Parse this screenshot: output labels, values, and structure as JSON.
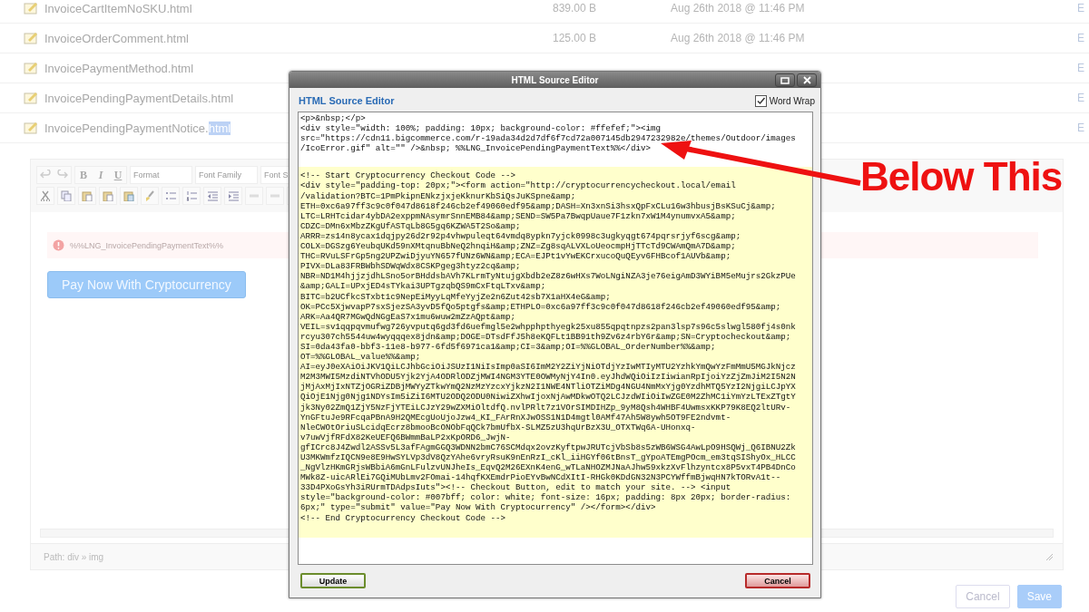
{
  "file_list": {
    "rows": [
      {
        "name": "InvoiceCartItemNoSKU.html",
        "size": "839.00 B",
        "date": "Aug 26th 2018 @ 11:46 PM",
        "column_4": "E"
      },
      {
        "name": "InvoiceOrderComment.html",
        "size": "125.00 B",
        "date": "Aug 26th 2018 @ 11:46 PM",
        "column_4": "E"
      },
      {
        "name": "InvoicePaymentMethod.html",
        "column_4": "E"
      },
      {
        "name": "InvoicePendingPaymentDetails.html",
        "column_4": "E"
      },
      {
        "name": "InvoicePendingPaymentNotice.",
        "selected_text": "html",
        "column_4": "E"
      }
    ]
  },
  "editor": {
    "toolbar": {
      "bold": "B",
      "italic": "I",
      "underline": "U",
      "format": "Format",
      "font_family": "Font Family",
      "font_size": "Font S"
    },
    "message": "%%LNG_InvoicePendingPaymentText%%",
    "button": "Pay Now With Cryptocurrency",
    "path": "Path: div » img"
  },
  "actions": [
    {
      "label": "Cancel",
      "kind": "secondary"
    },
    {
      "label": "Save",
      "kind": "primary"
    }
  ],
  "dialog": {
    "title": "HTML Source Editor",
    "heading": "HTML Source Editor",
    "word_wrap": {
      "label": "Word Wrap",
      "checked": true
    },
    "source_lines": [
      {
        "text": "<p>&nbsp;</p>",
        "highlighted": false
      },
      {
        "text": "<div style=\"width: 100%; padding: 10px; background-color: #ffefef;\"><img",
        "highlighted": false
      },
      {
        "text": "src=\"https://cdn11.bigcommerce.com/r-19ada34d2d7df6f7cd72a007145db2947232982e/themes/Outdoor/images",
        "highlighted": false
      },
      {
        "text": "/IcoError.gif\" alt=\"\" />&nbsp; %%LNG_InvoicePendingPaymentText%%</div>",
        "highlighted": false
      },
      {
        "text": "<!-- Start Cryptocurrency Checkout Code -->",
        "highlighted": true
      },
      {
        "text": "<div style=\"padding-top: 20px;\"><form action=\"http://cryptocurrencycheckout.local/email",
        "highlighted": true
      },
      {
        "text": "/validation?BTC=1PmPkipnENkzjxjeKknurKbSiQsJuKSpne&amp;",
        "highlighted": true
      },
      {
        "text": "ETH=0xc6a97ff3c9c0f047d8618f246cb2ef49060edf95&amp;DASH=Xn3xnSi3hsxQpFxCLu16w3hbusjBsKSuCj&amp;",
        "highlighted": true
      },
      {
        "text": "LTC=LRHTcidar4ybDA2exppmNAsymrSnnEMB84&amp;SEND=SW5Pa7BwqpUaue7F1zkn7xW1M4ynumvxA5&amp;",
        "highlighted": true
      },
      {
        "text": "CDZC=DMn6xMbzZKgUfASTqLb8G5gq6KZWA5T2So&amp;",
        "highlighted": true
      },
      {
        "text": "ARRR=zs14n8ycax1dqjpy26d2r92p4vhwpuleqt64vmdq8ypkn7yjck0998c3ugkyqgt674pqrsrjyf6scg&amp;",
        "highlighted": true
      },
      {
        "text": "COLX=DGSzg6YeubqUKd59nXMtqnuBbNeQ2hnqiH&amp;ZNZ=Zg8sqALVXLoUeocmpHjTTcTd9CWAmQmA7D&amp;",
        "highlighted": true
      },
      {
        "text": "THC=RVuLSFrGp5ng2UPZwiDjyuYN657fUNz6WN&amp;ECA=EJPt1vYwEKCrxucoQuQEyv6FHBcof1AUVb&amp;",
        "highlighted": true
      },
      {
        "text": "PIVX=DLa83FRBWbhSDWqWdx8CSKPgeg3htyz2cq&amp;",
        "highlighted": true
      },
      {
        "text": "NBR=ND1M4hjjzjdhLSno5orBHddsbAVh7KLrmTyNtujgXbdb2eZ8z6wHXs7WoLNgiNZA3je76eigAmD3WYiBM5eMujrs2GkzPUe",
        "highlighted": true
      },
      {
        "text": "&amp;GALI=UPxjED4sTYkai3UPTgzqbQS9mCxFtqLTxv&amp;",
        "highlighted": true
      },
      {
        "text": "BITC=b2UCfkcSTxbt1c9NepEiMyyLqMfeYyjZe2n6Zut42sb7X1aHX4eG&amp;",
        "highlighted": true
      },
      {
        "text": "OK=PCc5XjwvapP7sxSjezSA3yvD5fQo5ptgfs&amp;ETHPLO=0xc6a97ff3c9c0f047d8618f246cb2ef49060edf95&amp;",
        "highlighted": true
      },
      {
        "text": "ARK=Aa4QR7MGwQdNGgEaS7x1mu6wuw2mZzAQpt&amp;",
        "highlighted": true
      },
      {
        "text": "VEIL=sv1qqpqvmufwg726yvputq6gd3fd6uefmgl5e2whpphpthyegk25xu855qpqtnpzs2pan3lsp7s96c5slwgl580fj4s0nk",
        "highlighted": true
      },
      {
        "text": "rcyu307ch5544uw4wyqqqex8jdn&amp;DOGE=DTsdFfJ5h8eKQFLt1BB91th9Zv6z4rbY6r&amp;SN=Cryptocheckout&amp;",
        "highlighted": true
      },
      {
        "text": "SI=0da43fa0-bbf3-11e8-b977-6fd5f6971ca1&amp;CI=3&amp;OI=%%GLOBAL_OrderNumber%%&amp;",
        "highlighted": true
      },
      {
        "text": "OT=%%GLOBAL_value%%&amp;",
        "highlighted": true
      },
      {
        "text": "AI=eyJ0eXAiOiJKV1QiLCJhbGciOiJSUzI1NiIsImp0aSI6ImM2Y2ZiYjNiOTdjYzIwMTIyMTU2YzhkYmQwYzFmMmU5MGJkNjcz",
        "highlighted": true
      },
      {
        "text": "M2M3MWI5MzdiNTVhODU5Yjk2YjA4ODRlODZjMWI4NGM3YTE0OWMyNjY4In0.eyJhdWQiOiIzIiwianRpIjoiYzZjZmJiM2I5N2N",
        "highlighted": true
      },
      {
        "text": "jMjAxMjIxNTZjOGRiZDBjMWYyZTkwYmQ2NzMzYzcxYjkzN2I1NWE4NTliOTZiMDg4NGU4NmMxYjg0YzdhMTQ5YzI2NjgiLCJpYX",
        "highlighted": true
      },
      {
        "text": "QiOjE1Njg0Njg1NDYsIm5iZiI6MTU2ODQ2ODU0NiwiZXhwIjoxNjAwMDkwOTQ2LCJzdWIiOiIwZGE0M2ZhMC1iYmYzLTExZTgtY",
        "highlighted": true
      },
      {
        "text": "jk3Ny02ZmQ1ZjY5NzFjYTEiLCJzY29wZXMiOltdfQ.nvlPRlt7z1VOrSIMDIHZp_9yM8Qsh4WHBF4UwmsxKKP79K8EQ2ltURv-",
        "highlighted": true
      },
      {
        "text": "YnGFtuJe9RFcqaPBnA9H2QMEcgUoUjoJzw4_KI_FArRnXJwOSS1N1D4mgtl0AMf47Ah5W8ywh5OT9FE2ndvmt-",
        "highlighted": true
      },
      {
        "text": "NleCWOtOriuSLcidqEcrz8bmooBcONObFqQCk7bmUfbX-SLMZ5zU3hqUrBzX3U_OTXTWq6A-UHonxq-",
        "highlighted": true
      },
      {
        "text": "v7uwVjfRFdX82KeUEFQ6BWmmBaLP2xKpORD6_JwjN-",
        "highlighted": true
      },
      {
        "text": "gfICrc8J4Zwdl2ASSv5L3afFAgmGGQ3WDNN2bmC76SCMdqx2ovzKyftpwJRUTcjVbSb8s5zWB6WSG4AwLpO9HSQWj_Q6IBNU2Zk",
        "highlighted": true
      },
      {
        "text": "U3MKWmfzIQCN9e8E9HwSYLVp3dV8QzYAhe6vryRsuK9nEnRzI_cKl_iiHGYf06tBnsT_gYpoATEmgPOcm_em3tqSIShyOx_HLCC",
        "highlighted": true
      },
      {
        "text": "_NgVlzHKmGRjsWBbiA6mGnLFulzvUNJheIs_EqvQ2M26EXnK4enG_wTLaNHOZMJNaAJhw59xkzXvFlhzyntcx8P5vxT4PB4DnCo",
        "highlighted": true
      },
      {
        "text": "MWk8Z-uicARlEi7GQiMUbLmv2FOmai-14hqfKXEmdrPioEYvBwNCdXItI-RHGk0KDdGN32N3PCYWffmBjwqHN7kTORvA1t--",
        "highlighted": true
      },
      {
        "text": "33D4PXoGsYh3iRUrmTDAdpsIuts\"><!-- Checkout Button, edit to match your site. --> <input",
        "highlighted": true
      },
      {
        "text": "style=\"background-color: #007bff; color: white; font-size: 16px; padding: 8px 20px; border-radius:",
        "highlighted": true
      },
      {
        "text": "6px;\" type=\"submit\" value=\"Pay Now With Cryptocurrency\" /></form></div>",
        "highlighted": true
      },
      {
        "text": "<!-- End Cryptocurrency Checkout Code -->",
        "highlighted": true
      }
    ],
    "buttons": [
      {
        "label": "Update",
        "kind": "confirm"
      },
      {
        "label": "Cancel",
        "kind": "cancel"
      }
    ]
  },
  "annotation": {
    "text": "Below This"
  }
}
